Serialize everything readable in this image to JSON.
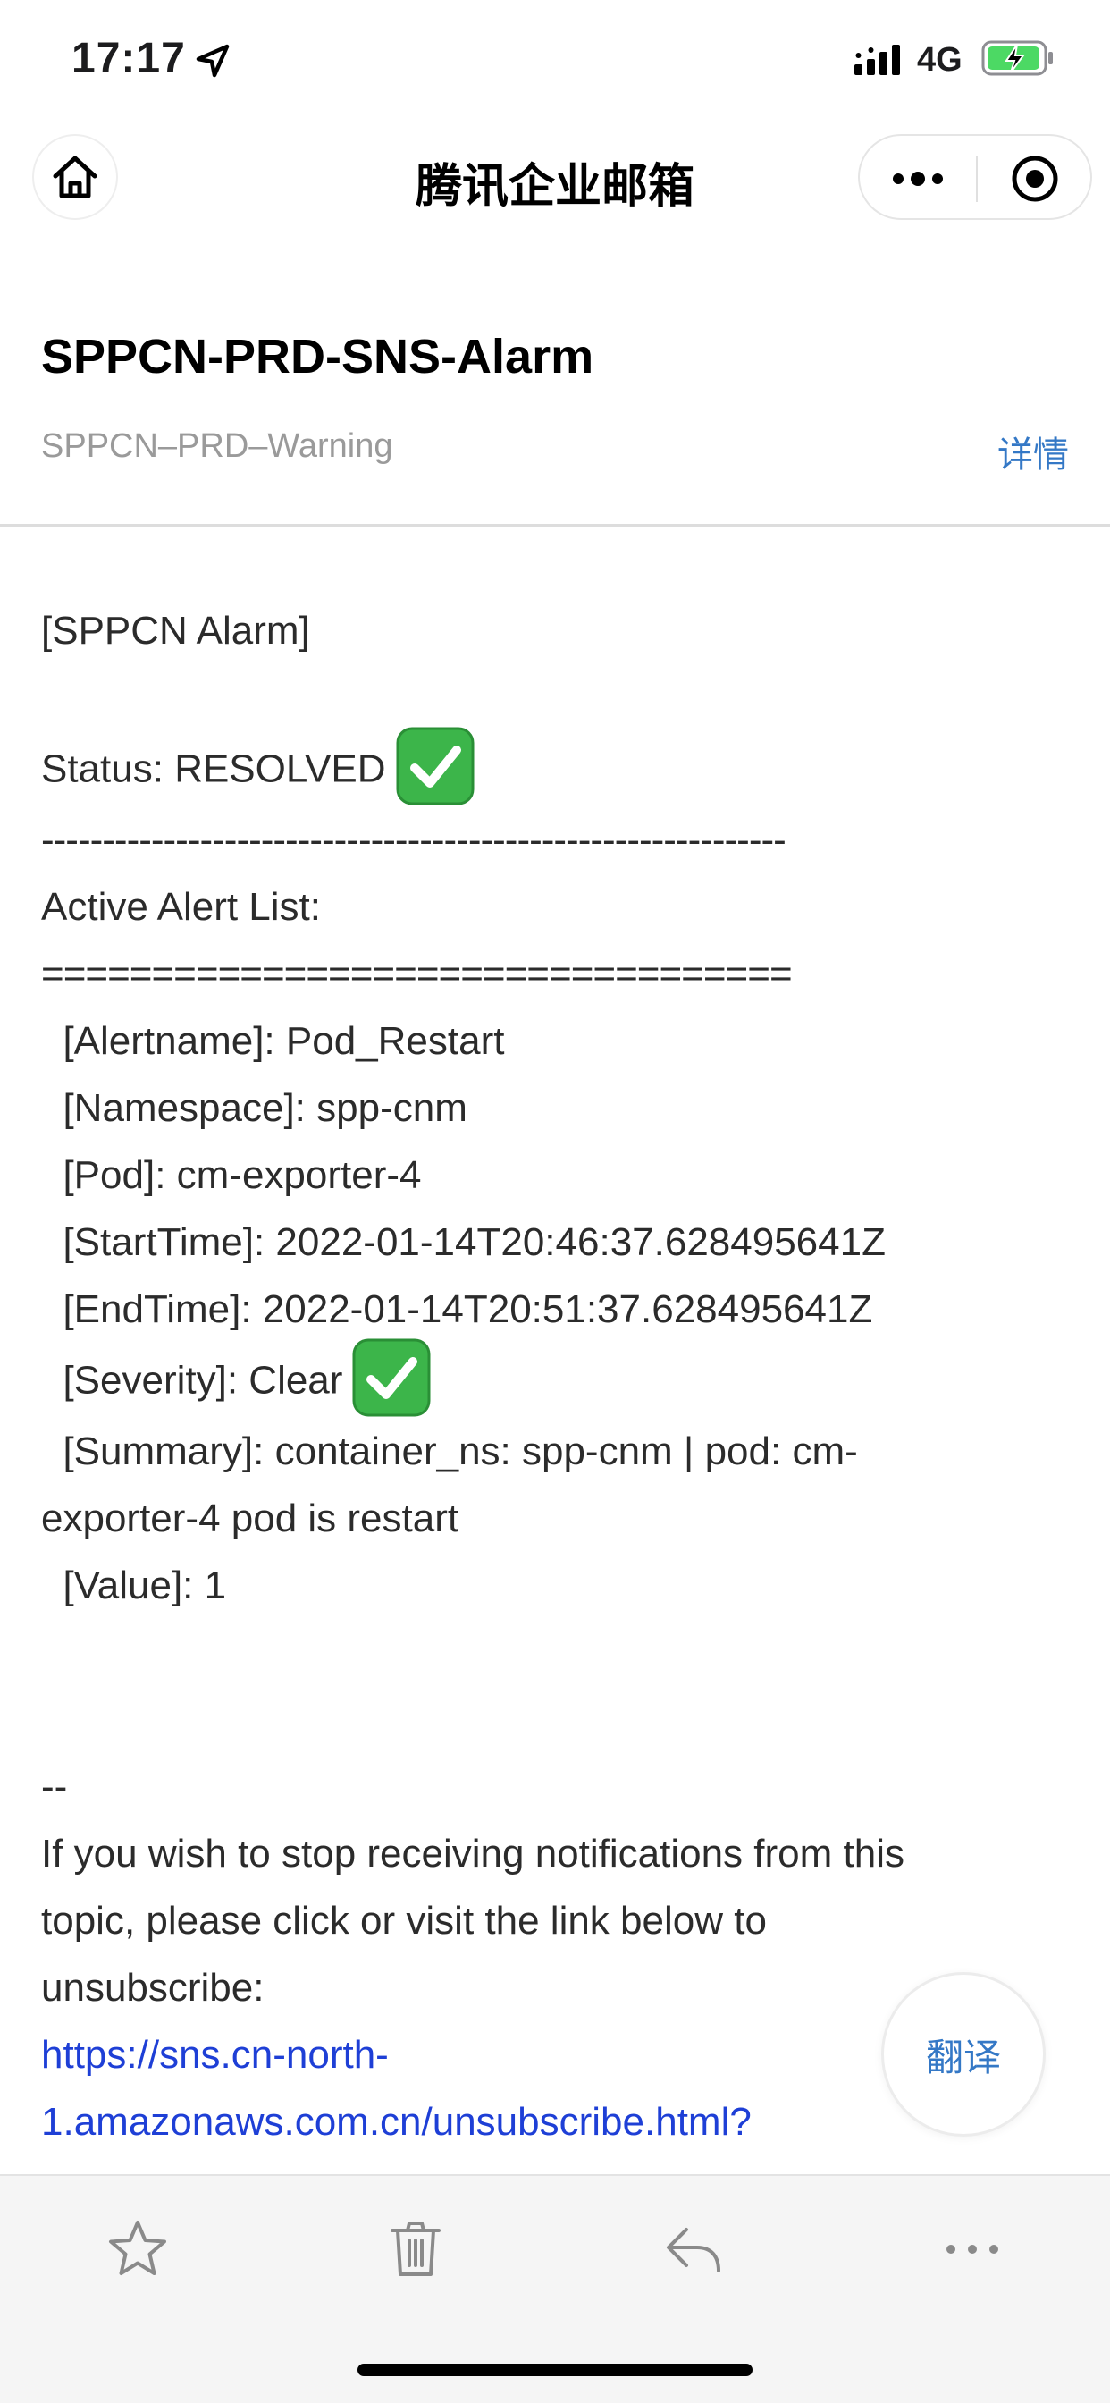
{
  "status_bar": {
    "time": "17:17",
    "network": "4G",
    "icons": [
      "location-arrow-icon",
      "signal-icon",
      "battery-charging-icon"
    ]
  },
  "nav": {
    "title": "腾讯企业邮箱",
    "home_icon": "home-icon",
    "more_icon": "more-dots-icon",
    "close_icon": "close-circle-icon"
  },
  "mail": {
    "subject": "SPPCN-PRD-SNS-Alarm",
    "sender": "SPPCN–PRD–Warning",
    "details_label": "详情",
    "body": {
      "header": "[SPPCN Alarm]",
      "status": "Status: RESOLVED",
      "dash_separator": "-------------------------------------------------------------",
      "list_title": "Active Alert List:",
      "eq_separator": "==================================",
      "alertname": "  [Alertname]: Pod_Restart",
      "namespace": "  [Namespace]: spp-cnm",
      "pod": "  [Pod]: cm-exporter-4",
      "start_time": "  [StartTime]: 2022-01-14T20:46:37.628495641Z",
      "end_time": "  [EndTime]: 2022-01-14T20:51:37.628495641Z",
      "severity": "  [Severity]: Clear",
      "summary_line1": "  [Summary]: container_ns: spp-cnm | pod: cm-",
      "summary_line2": "exporter-4 pod is restart",
      "value": "  [Value]: 1",
      "signature": "--",
      "unsubscribe_line1": "If you wish to stop receiving notifications from this",
      "unsubscribe_line2": "topic, please click or visit the link below to",
      "unsubscribe_line3": "unsubscribe:",
      "link_line1": "https://sns.cn-north-",
      "link_line2": "1.amazonaws.com.cn/unsubscribe.html?"
    },
    "check_emoji_color": "#3cb54a"
  },
  "translate_label": "翻译",
  "toolbar": {
    "items": [
      "star-icon",
      "trash-icon",
      "reply-icon",
      "more-dots-icon"
    ]
  }
}
